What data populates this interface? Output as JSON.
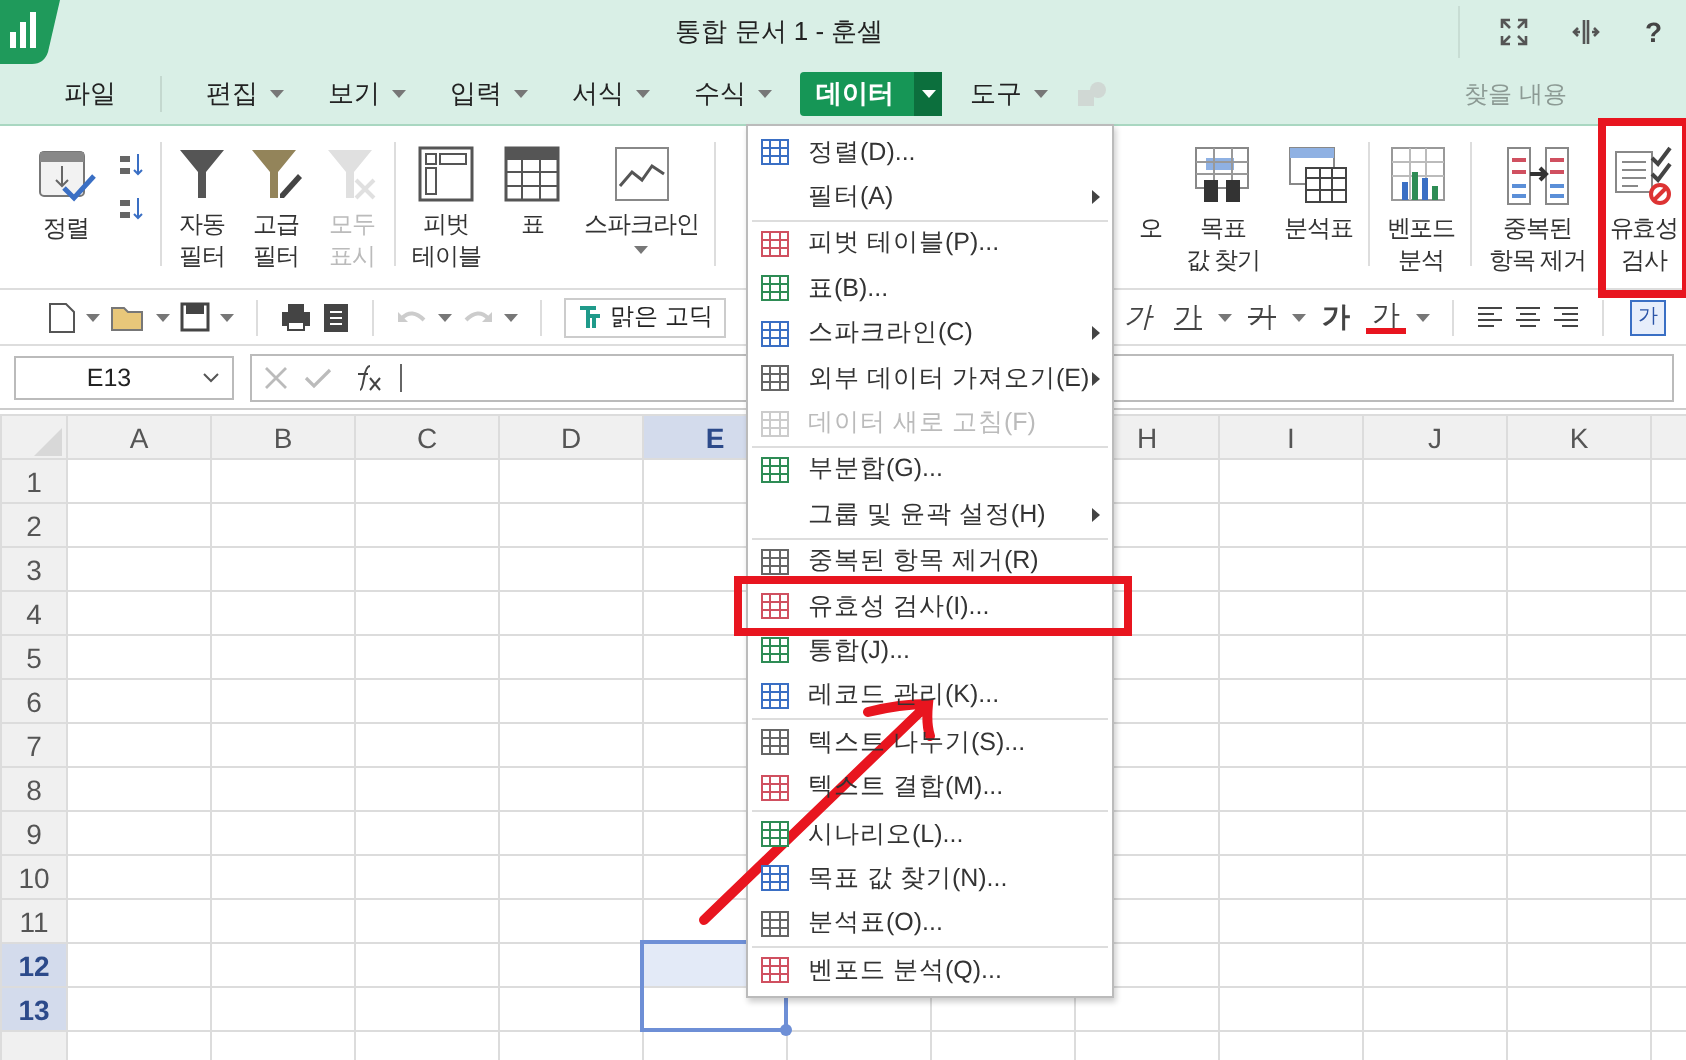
{
  "window": {
    "title": "통합 문서 1 - 훈셀",
    "help": "?"
  },
  "menubar": {
    "items": [
      {
        "label": "파일",
        "dropdown": false,
        "selected": false
      },
      {
        "label": "편집",
        "dropdown": true,
        "selected": false
      },
      {
        "label": "보기",
        "dropdown": true,
        "selected": false
      },
      {
        "label": "입력",
        "dropdown": true,
        "selected": false
      },
      {
        "label": "서식",
        "dropdown": true,
        "selected": false
      },
      {
        "label": "수식",
        "dropdown": true,
        "selected": false
      },
      {
        "label": "데이터",
        "dropdown": true,
        "selected": true
      },
      {
        "label": "도구",
        "dropdown": true,
        "selected": false
      }
    ],
    "search": {
      "placeholder": "찾을 내용"
    }
  },
  "ribbon": {
    "left": [
      [
        {
          "label": "정렬",
          "disabled": false,
          "highlighted": false
        }
      ],
      [
        {
          "label": "자동\n필터",
          "disabled": false,
          "highlighted": false
        },
        {
          "label": "고급\n필터",
          "disabled": false,
          "highlighted": false
        },
        {
          "label": "모두\n표시",
          "disabled": true,
          "highlighted": false
        }
      ],
      [
        {
          "label": "피벗\n테이블",
          "disabled": false,
          "highlighted": false
        },
        {
          "label": "표",
          "disabled": false,
          "highlighted": false
        },
        {
          "label": "스파크라인",
          "disabled": false,
          "highlighted": false,
          "dropdown": true
        }
      ]
    ],
    "right": [
      [
        {
          "label": "오",
          "disabled": false,
          "highlighted": false
        },
        {
          "label": "목표\n값 찾기",
          "disabled": false,
          "highlighted": false
        },
        {
          "label": "분석표",
          "disabled": false,
          "highlighted": false
        }
      ],
      [
        {
          "label": "벤포드\n분석",
          "disabled": false,
          "highlighted": false
        }
      ],
      [
        {
          "label": "중복된\n항목 제거",
          "disabled": false,
          "highlighted": false
        },
        {
          "label": "유효성\n검사",
          "disabled": false,
          "highlighted": true
        }
      ]
    ]
  },
  "toolbar": {
    "font": "맑은 고딕",
    "format_buttons": [
      {
        "label": "가",
        "kind": "italic"
      },
      {
        "label": "가",
        "kind": "underline"
      },
      {
        "label": "가",
        "kind": "strike"
      },
      {
        "label": "가",
        "kind": "bold"
      },
      {
        "label": "가",
        "kind": "color"
      }
    ],
    "cell_style": "가"
  },
  "formula_bar": {
    "name_box": "E13"
  },
  "grid": {
    "columns": [
      {
        "label": "A",
        "selected": false
      },
      {
        "label": "B",
        "selected": false
      },
      {
        "label": "C",
        "selected": false
      },
      {
        "label": "D",
        "selected": false
      },
      {
        "label": "E",
        "selected": true
      },
      null,
      null,
      {
        "label": "H",
        "selected": false
      },
      {
        "label": "I",
        "selected": false
      },
      {
        "label": "J",
        "selected": false
      },
      {
        "label": "K",
        "selected": false
      }
    ],
    "rows": [
      {
        "label": "1",
        "selected": false
      },
      {
        "label": "2",
        "selected": false
      },
      {
        "label": "3",
        "selected": false
      },
      {
        "label": "4",
        "selected": false
      },
      {
        "label": "5",
        "selected": false
      },
      {
        "label": "6",
        "selected": false
      },
      {
        "label": "7",
        "selected": false
      },
      {
        "label": "8",
        "selected": false
      },
      {
        "label": "9",
        "selected": false
      },
      {
        "label": "10",
        "selected": false
      },
      {
        "label": "11",
        "selected": false
      },
      {
        "label": "12",
        "selected": true
      },
      {
        "label": "13",
        "selected": true
      }
    ]
  },
  "menu": {
    "items": [
      {
        "label": "정렬(D)...",
        "icon": true,
        "submenu": false,
        "disabled": false,
        "separator_before": false,
        "highlighted": false
      },
      {
        "label": "필터(A)",
        "icon": false,
        "submenu": true,
        "disabled": false,
        "separator_before": false,
        "highlighted": false
      },
      {
        "label": "피벗 테이블(P)...",
        "icon": true,
        "submenu": false,
        "disabled": false,
        "separator_before": true,
        "highlighted": false
      },
      {
        "label": "표(B)...",
        "icon": true,
        "submenu": false,
        "disabled": false,
        "separator_before": false,
        "highlighted": false
      },
      {
        "label": "스파크라인(C)",
        "icon": true,
        "submenu": true,
        "disabled": false,
        "separator_before": false,
        "highlighted": false
      },
      {
        "label": "외부 데이터 가져오기(E)",
        "icon": true,
        "submenu": true,
        "disabled": false,
        "separator_before": false,
        "highlighted": false
      },
      {
        "label": "데이터 새로 고침(F)",
        "icon": true,
        "submenu": false,
        "disabled": true,
        "separator_before": false,
        "highlighted": false
      },
      {
        "label": "부분합(G)...",
        "icon": true,
        "submenu": false,
        "disabled": false,
        "separator_before": true,
        "highlighted": false
      },
      {
        "label": "그룹 및 윤곽 설정(H)",
        "icon": false,
        "submenu": true,
        "disabled": false,
        "separator_before": false,
        "highlighted": false
      },
      {
        "label": "중복된 항목 제거(R)",
        "icon": true,
        "submenu": false,
        "disabled": false,
        "separator_before": true,
        "highlighted": false
      },
      {
        "label": "유효성 검사(I)...",
        "icon": true,
        "submenu": false,
        "disabled": false,
        "separator_before": false,
        "highlighted": true
      },
      {
        "label": "통합(J)...",
        "icon": true,
        "submenu": false,
        "disabled": false,
        "separator_before": false,
        "highlighted": false
      },
      {
        "label": "레코드 관리(K)...",
        "icon": true,
        "submenu": false,
        "disabled": false,
        "separator_before": false,
        "highlighted": false
      },
      {
        "label": "텍스트 나누기(S)...",
        "icon": true,
        "submenu": false,
        "disabled": false,
        "separator_before": true,
        "highlighted": false
      },
      {
        "label": "텍스트 결합(M)...",
        "icon": true,
        "submenu": false,
        "disabled": false,
        "separator_before": false,
        "highlighted": false
      },
      {
        "label": "시나리오(L)...",
        "icon": true,
        "submenu": false,
        "disabled": false,
        "separator_before": true,
        "highlighted": false
      },
      {
        "label": "목표 값 찾기(N)...",
        "icon": true,
        "submenu": false,
        "disabled": false,
        "separator_before": false,
        "highlighted": false
      },
      {
        "label": "분석표(O)...",
        "icon": true,
        "submenu": false,
        "disabled": false,
        "separator_before": false,
        "highlighted": false
      },
      {
        "label": "벤포드 분석(Q)...",
        "icon": true,
        "submenu": false,
        "disabled": false,
        "separator_before": true,
        "highlighted": false
      }
    ]
  }
}
